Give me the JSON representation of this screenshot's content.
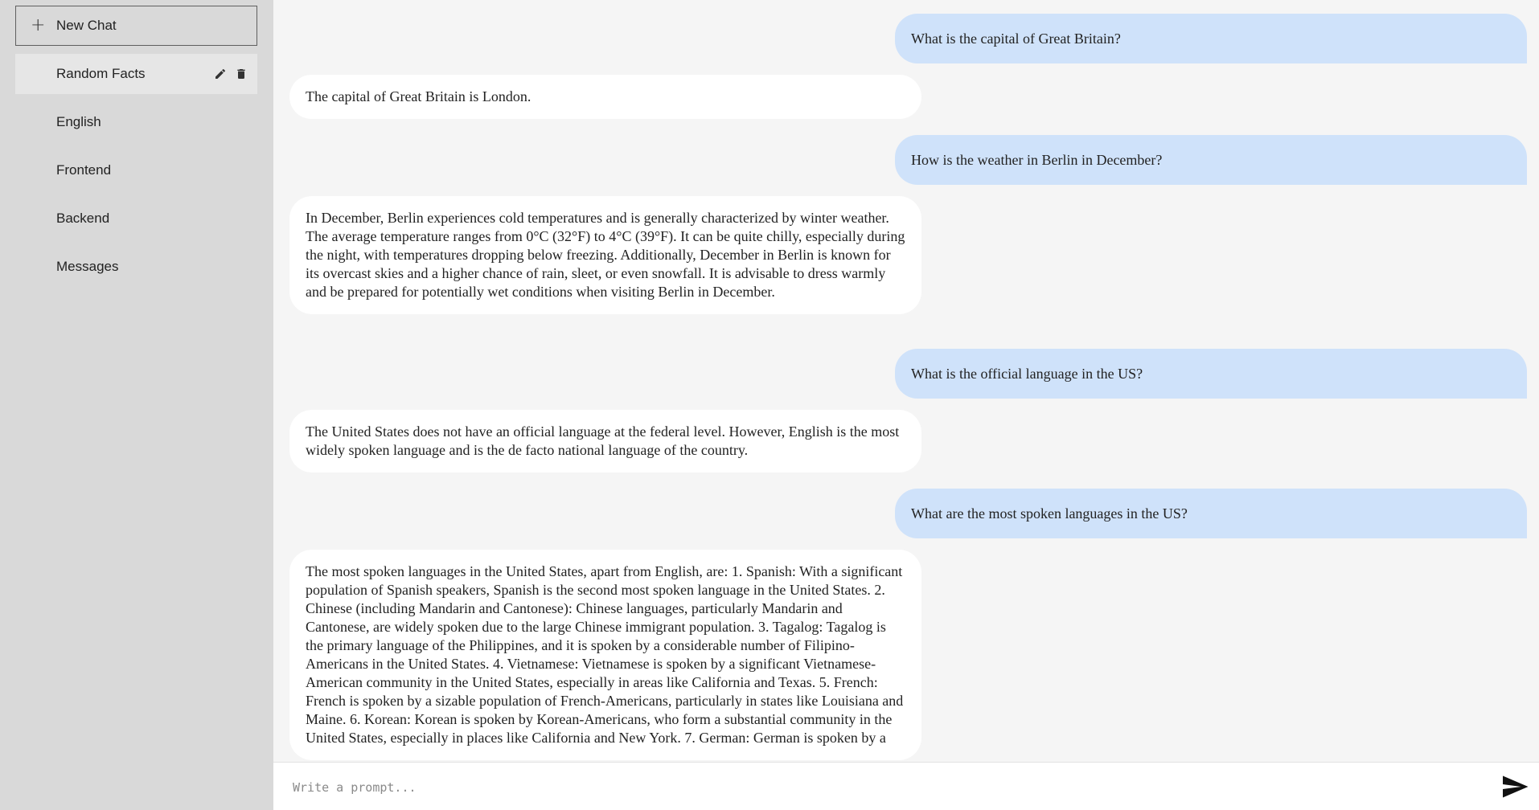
{
  "sidebar": {
    "new_chat_label": "New Chat",
    "items": [
      {
        "label": "Random Facts",
        "active": true
      },
      {
        "label": "English"
      },
      {
        "label": "Frontend"
      },
      {
        "label": "Backend"
      },
      {
        "label": "Messages"
      }
    ]
  },
  "messages": [
    {
      "role": "user",
      "text": "What is the capital of Great Britain?"
    },
    {
      "role": "assistant",
      "text": "The capital of Great Britain is London."
    },
    {
      "role": "user",
      "text": "How is the weather in Berlin in December?"
    },
    {
      "role": "assistant",
      "text": "In December, Berlin experiences cold temperatures and is generally characterized by winter weather. The average temperature ranges from 0°C (32°F) to 4°C (39°F). It can be quite chilly, especially during the night, with temperatures dropping below freezing. Additionally, December in Berlin is known for its overcast skies and a higher chance of rain, sleet, or even snowfall. It is advisable to dress warmly and be prepared for potentially wet conditions when visiting Berlin in December."
    },
    {
      "role": "user",
      "text": "What is the official language in the US?"
    },
    {
      "role": "assistant",
      "text": "The United States does not have an official language at the federal level. However, English is the most widely spoken language and is the de facto national language of the country."
    },
    {
      "role": "user",
      "text": "What are the most spoken languages in the US?"
    },
    {
      "role": "assistant",
      "text": "The most spoken languages in the United States, apart from English, are: 1. Spanish: With a significant population of Spanish speakers, Spanish is the second most spoken language in the United States. 2. Chinese (including Mandarin and Cantonese): Chinese languages, particularly Mandarin and Cantonese, are widely spoken due to the large Chinese immigrant population. 3. Tagalog: Tagalog is the primary language of the Philippines, and it is spoken by a considerable number of Filipino-Americans in the United States. 4. Vietnamese: Vietnamese is spoken by a significant Vietnamese-American community in the United States, especially in areas like California and Texas. 5. French: French is spoken by a sizable population of French-Americans, particularly in states like Louisiana and Maine. 6. Korean: Korean is spoken by Korean-Americans, who form a substantial community in the United States, especially in places like California and New York. 7. German: German is spoken by a"
    }
  ],
  "input": {
    "placeholder": "Write a prompt..."
  },
  "icons": {
    "new_chat": "plus-icon",
    "edit": "pencil-icon",
    "delete": "trash-icon",
    "send": "send-icon"
  },
  "colors": {
    "sidebar_bg": "#d9d9d9",
    "active_item_bg": "#e6e6e6",
    "main_bg": "#f5f5f5",
    "user_bubble": "#cfe2fa",
    "assistant_bubble": "#ffffff"
  }
}
